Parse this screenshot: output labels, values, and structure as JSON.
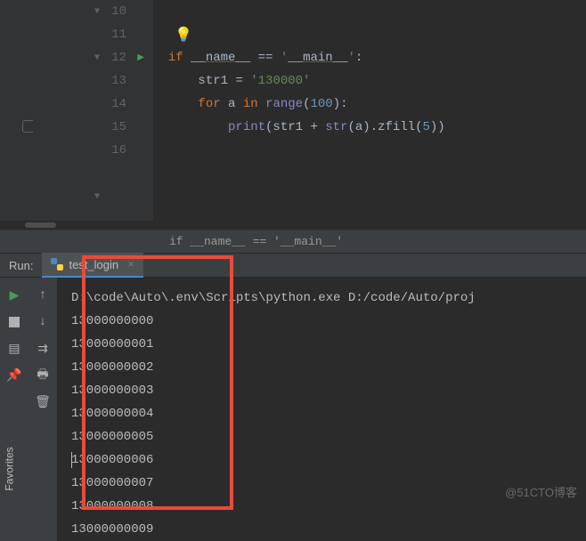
{
  "gutter": {
    "lines": [
      "10",
      "11",
      "12",
      "13",
      "14",
      "15",
      "16"
    ]
  },
  "code": {
    "if": "if",
    "name_dunder": "__name__",
    "eq": "==",
    "main_str_pre": "'",
    "main_str_mid": "__main__",
    "main_str_post": "'",
    "colon": ":",
    "str1": "str1",
    "assign": "=",
    "val1": "'130000'",
    "for": "for",
    "a": "a",
    "in": "in",
    "range": "range",
    "lp": "(",
    "hundred": "100",
    "rp_colon": "):",
    "print": "print",
    "print_args_1": "(str1 + ",
    "str_fn": "str",
    "print_args_2": "(a).zfill(",
    "five": "5",
    "print_args_3": "))"
  },
  "breadcrumb": "if __name__ == '__main__'",
  "run": {
    "label": "Run:",
    "tab": "test_login"
  },
  "console": {
    "cmd": "D:\\code\\Auto\\.env\\Scripts\\python.exe D:/code/Auto/proj",
    "lines": [
      "13000000000",
      "13000000001",
      "13000000002",
      "13000000003",
      "13000000004",
      "13000000005",
      "13000000006",
      "13000000007",
      "13000000008",
      "13000000009"
    ]
  },
  "sidebar": {
    "favorites": "Favorites"
  },
  "watermark": "@51CTO博客"
}
